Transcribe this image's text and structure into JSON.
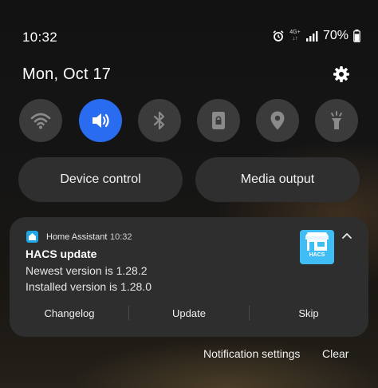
{
  "status": {
    "time": "10:32",
    "network": {
      "top": "4G+",
      "bottom": "↓↑"
    },
    "battery": "70%"
  },
  "panel": {
    "date": "Mon, Oct 17",
    "settings_icon": "gear-icon"
  },
  "quick_tiles": [
    {
      "name": "wifi",
      "icon": "wifi-icon",
      "active": false
    },
    {
      "name": "sound",
      "icon": "speaker-icon",
      "active": true
    },
    {
      "name": "bluetooth",
      "icon": "bluetooth-icon",
      "active": false
    },
    {
      "name": "screen-lock",
      "icon": "lock-icon",
      "active": false
    },
    {
      "name": "location",
      "icon": "location-pin-icon",
      "active": false
    },
    {
      "name": "flashlight",
      "icon": "flashlight-icon",
      "active": false
    }
  ],
  "buttons": {
    "device_control": "Device control",
    "media_output": "Media output"
  },
  "notification": {
    "app": "Home Assistant",
    "time": "10:32",
    "title": "HACS update",
    "line1": "Newest version is 1.28.2",
    "line2": "Installed version is 1.28.0",
    "logo_text": "HACS",
    "actions": [
      "Changelog",
      "Update",
      "Skip"
    ]
  },
  "footer": {
    "settings": "Notification settings",
    "clear": "Clear"
  },
  "colors": {
    "accent_active_tile": "#2a6cf0",
    "hacs_logo": "#41bdf5",
    "home_assistant_icon": "#1ea7e6"
  }
}
